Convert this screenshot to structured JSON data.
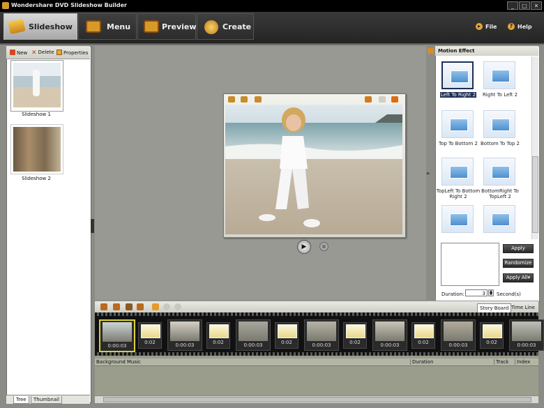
{
  "window": {
    "title": "Wondershare DVD Slideshow Builder",
    "minimize": "_",
    "restore": "□",
    "close": "✕"
  },
  "tabs": [
    {
      "label": "Slideshow",
      "icon": "slideshow-icon",
      "active": true
    },
    {
      "label": "Menu",
      "icon": "menu-icon"
    },
    {
      "label": "Preview",
      "icon": "preview-icon"
    },
    {
      "label": "Create",
      "icon": "create-disc-icon"
    }
  ],
  "top_right": {
    "file": "File",
    "help": "Help"
  },
  "left_panel": {
    "new": "New",
    "delete": "Delete",
    "properties": "Properties",
    "slideshows": [
      {
        "name": "Slideshow 1"
      },
      {
        "name": "Slideshow 2"
      }
    ],
    "bottom_tabs": [
      "Tree",
      "Thumbnail"
    ]
  },
  "right_panel": {
    "title": "Motion Effect",
    "effects": [
      {
        "name": "Left To Right 2",
        "selected": true
      },
      {
        "name": "Right To Left 2"
      },
      {
        "name": "Top To Bottom 2"
      },
      {
        "name": "Bottom To Top 2"
      },
      {
        "name": "TopLeft To Bottom Right 2"
      },
      {
        "name": "BottomRight To TopLeft 2"
      },
      {
        "name": ""
      },
      {
        "name": ""
      }
    ],
    "buttons": {
      "apply": "Apply",
      "randomize": "Randomize",
      "apply_all": "Apply All"
    },
    "duration_label": "Duration:",
    "duration_value": "3",
    "duration_unit": "Second(s)"
  },
  "storyboard": {
    "tabs": [
      "Story Board",
      "Time Line"
    ],
    "clips": [
      {
        "time": "0:00:03",
        "selected": true
      },
      {
        "time": "0:02",
        "transition": true
      },
      {
        "time": "0:00:03"
      },
      {
        "time": "0:02",
        "transition": true
      },
      {
        "time": "0:00:03"
      },
      {
        "time": "0:02",
        "transition": true
      },
      {
        "time": "0:00:03"
      },
      {
        "time": "0:02",
        "transition": true
      },
      {
        "time": "0:00:03"
      },
      {
        "time": "0:02",
        "transition": true
      },
      {
        "time": "0:00:03"
      },
      {
        "time": "0:02",
        "transition": true
      },
      {
        "time": "0:00:03"
      }
    ]
  },
  "music_track": {
    "headers": [
      "Background Music",
      "Duration",
      "Track",
      "Index"
    ]
  },
  "colors": {
    "accent_orange": "#e8a531",
    "selection_navy": "#1c2f55",
    "panel_gray": "#8c8c86",
    "clip_highlight": "#d9cf3a"
  }
}
